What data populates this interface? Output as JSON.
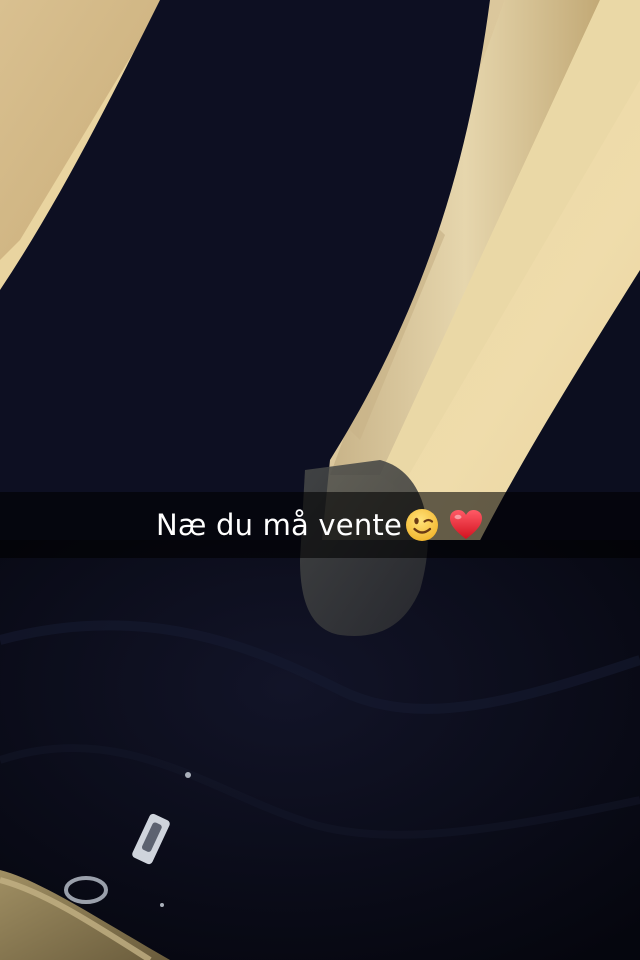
{
  "snap": {
    "caption": "Næ du må vente",
    "emojis": [
      "winking-face",
      "red-heart"
    ]
  },
  "colors": {
    "wall": "#e9d7a3",
    "door_frame": "#d9c59a",
    "fabric": "#0b0c1c",
    "caption_bg": "#000000",
    "caption_text": "#ffffff"
  }
}
